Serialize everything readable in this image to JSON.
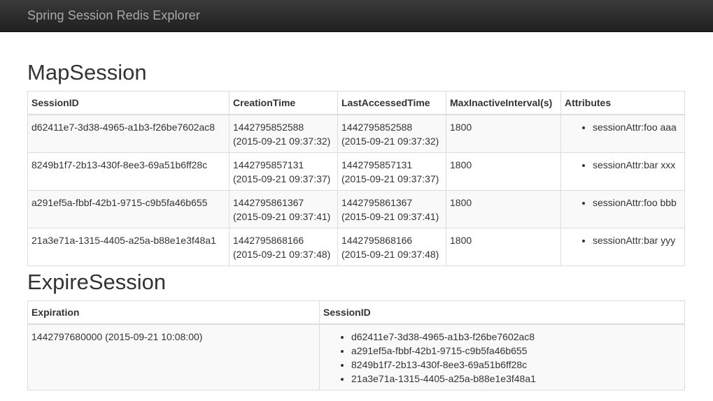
{
  "navbar": {
    "brand": "Spring Session Redis Explorer"
  },
  "map_session": {
    "title": "MapSession",
    "headers": {
      "session_id": "SessionID",
      "creation_time": "CreationTime",
      "last_accessed_time": "LastAccessedTime",
      "max_inactive_interval": "MaxInactiveInterval(s)",
      "attributes": "Attributes"
    },
    "rows": [
      {
        "session_id": "d62411e7-3d38-4965-a1b3-f26be7602ac8",
        "creation_ms": "1442795852588",
        "creation_dt": "(2015-09-21 09:37:32)",
        "last_ms": "1442795852588",
        "last_dt": "(2015-09-21 09:37:32)",
        "max_inactive": "1800",
        "attribute": "sessionAttr:foo aaa"
      },
      {
        "session_id": "8249b1f7-2b13-430f-8ee3-69a51b6ff28c",
        "creation_ms": "1442795857131",
        "creation_dt": "(2015-09-21 09:37:37)",
        "last_ms": "1442795857131",
        "last_dt": "(2015-09-21 09:37:37)",
        "max_inactive": "1800",
        "attribute": "sessionAttr:bar xxx"
      },
      {
        "session_id": "a291ef5a-fbbf-42b1-9715-c9b5fa46b655",
        "creation_ms": "1442795861367",
        "creation_dt": "(2015-09-21 09:37:41)",
        "last_ms": "1442795861367",
        "last_dt": "(2015-09-21 09:37:41)",
        "max_inactive": "1800",
        "attribute": "sessionAttr:foo bbb"
      },
      {
        "session_id": "21a3e71a-1315-4405-a25a-b88e1e3f48a1",
        "creation_ms": "1442795868166",
        "creation_dt": "(2015-09-21 09:37:48)",
        "last_ms": "1442795868166",
        "last_dt": "(2015-09-21 09:37:48)",
        "max_inactive": "1800",
        "attribute": "sessionAttr:bar yyy"
      }
    ]
  },
  "expire_session": {
    "title": "ExpireSession",
    "headers": {
      "expiration": "Expiration",
      "session_id": "SessionID"
    },
    "rows": [
      {
        "expiration": "1442797680000 (2015-09-21 10:08:00)",
        "session_ids": [
          "d62411e7-3d38-4965-a1b3-f26be7602ac8",
          "a291ef5a-fbbf-42b1-9715-c9b5fa46b655",
          "8249b1f7-2b13-430f-8ee3-69a51b6ff28c",
          "21a3e71a-1315-4405-a25a-b88e1e3f48a1"
        ]
      }
    ]
  }
}
